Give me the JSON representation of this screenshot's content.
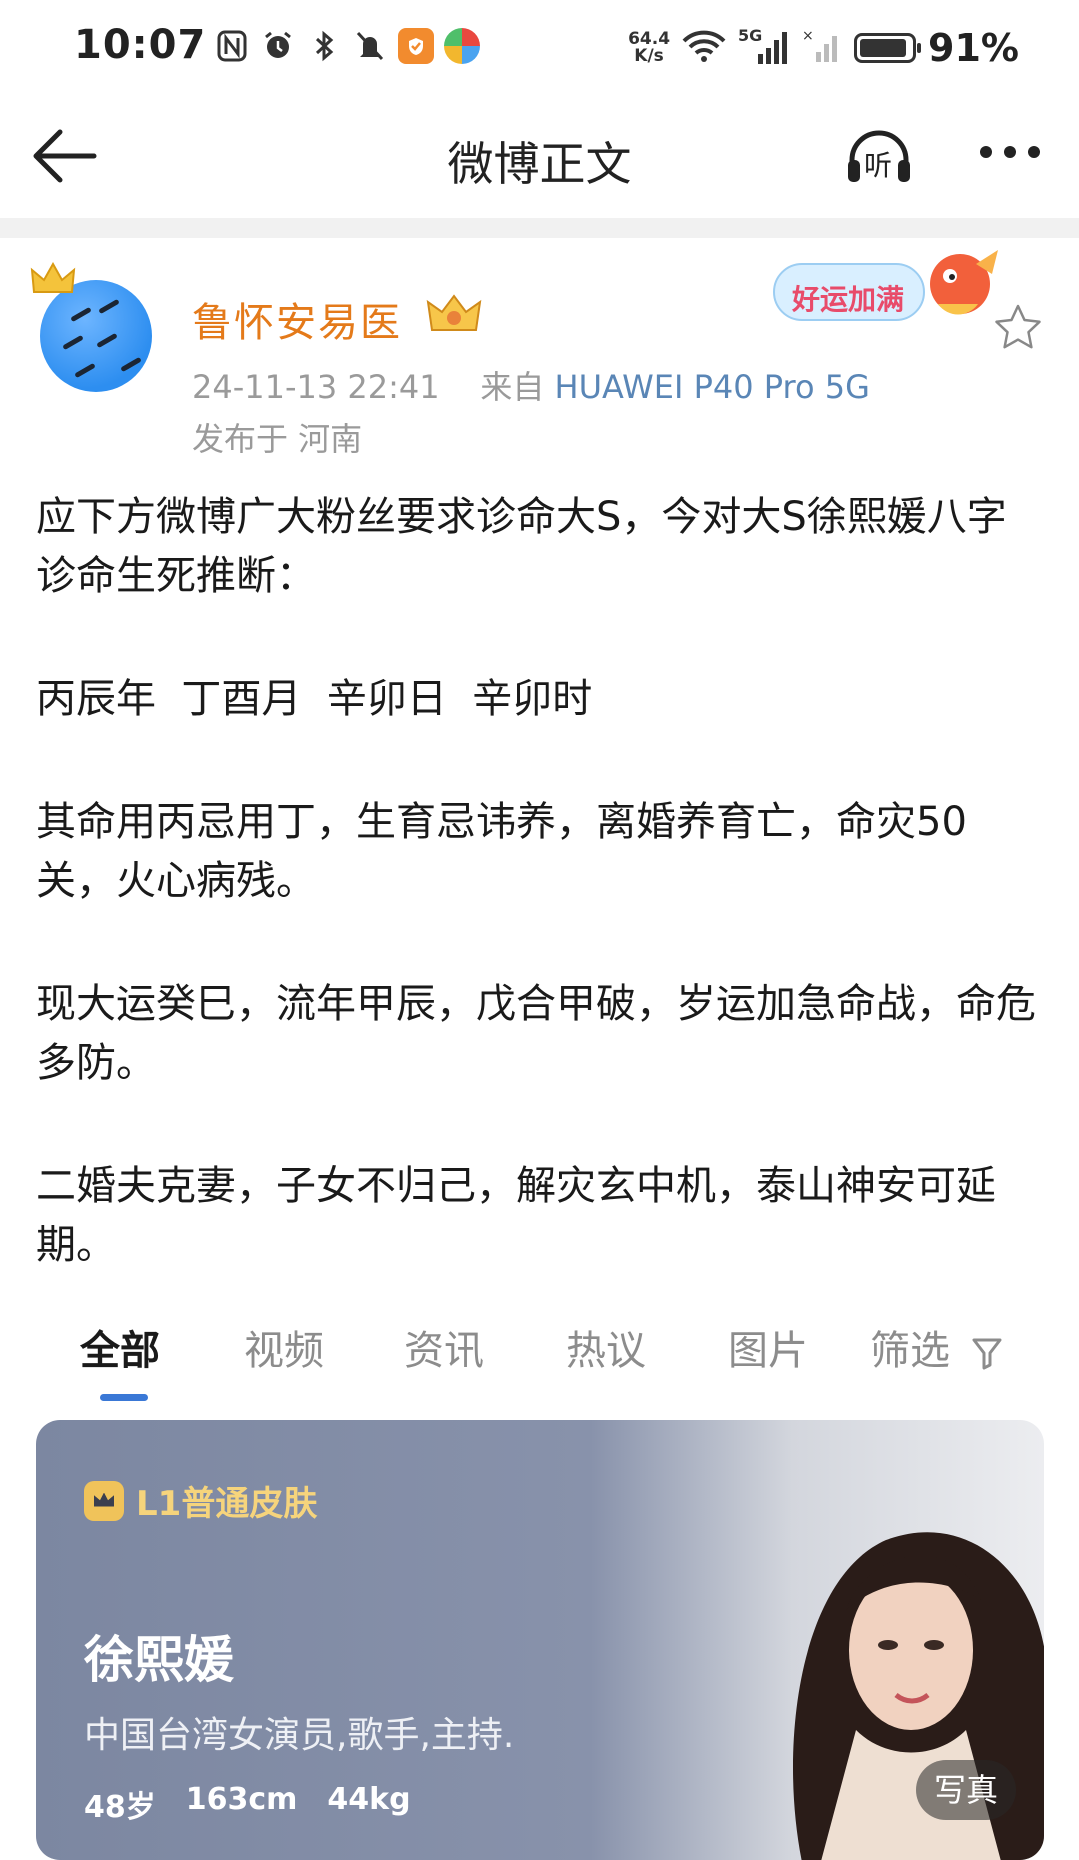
{
  "status_bar": {
    "time": "10:07",
    "speed_value": "64.4",
    "speed_unit": "K/s",
    "network": "5G",
    "battery": "91%"
  },
  "nav": {
    "title": "微博正文",
    "listen_label": "听"
  },
  "post": {
    "author": "鲁怀安易医",
    "timestamp": "24-11-13 22:41",
    "source_prefix": "来自",
    "device": "HUAWEI P40 Pro 5G",
    "location": "发布于 河南",
    "badge_text": "好运加满",
    "paragraphs": [
      "应下方微博广大粉丝要求诊命大S，今对大S徐熙媛八字诊命生死推断：",
      "丙辰年  丁酉月  辛卯日  辛卯时",
      "其命用丙忌用丁，生育忌讳养，离婚养育亡，命灾50关，火心病残。",
      "现大运癸巳，流年甲辰，戊合甲破，岁运加急命战，命危多防。",
      "二婚夫克妻，子女不归己，解灾玄中机，泰山神安可延期。"
    ]
  },
  "tabs": [
    {
      "label": "全部",
      "active": true
    },
    {
      "label": "视频",
      "active": false
    },
    {
      "label": "资讯",
      "active": false
    },
    {
      "label": "热议",
      "active": false
    },
    {
      "label": "图片",
      "active": false
    },
    {
      "label": "筛选",
      "active": false
    }
  ],
  "card": {
    "level": "L1普通皮肤",
    "name": "徐熙媛",
    "description": "中国台湾女演员,歌手,主持.",
    "stats": [
      "48岁",
      "163cm",
      "44kg"
    ],
    "photo_tag": "写真"
  },
  "colors": {
    "author": "#e47a1a",
    "device": "#5a86b6",
    "tab_indicator": "#3a78d6",
    "card_bg": "#7c87a1",
    "level_text": "#f6d47c"
  },
  "icons": [
    "back-arrow-icon",
    "headphones-icon",
    "more-icon",
    "crown-icon",
    "vip-badge-icon",
    "star-icon",
    "filter-icon"
  ]
}
